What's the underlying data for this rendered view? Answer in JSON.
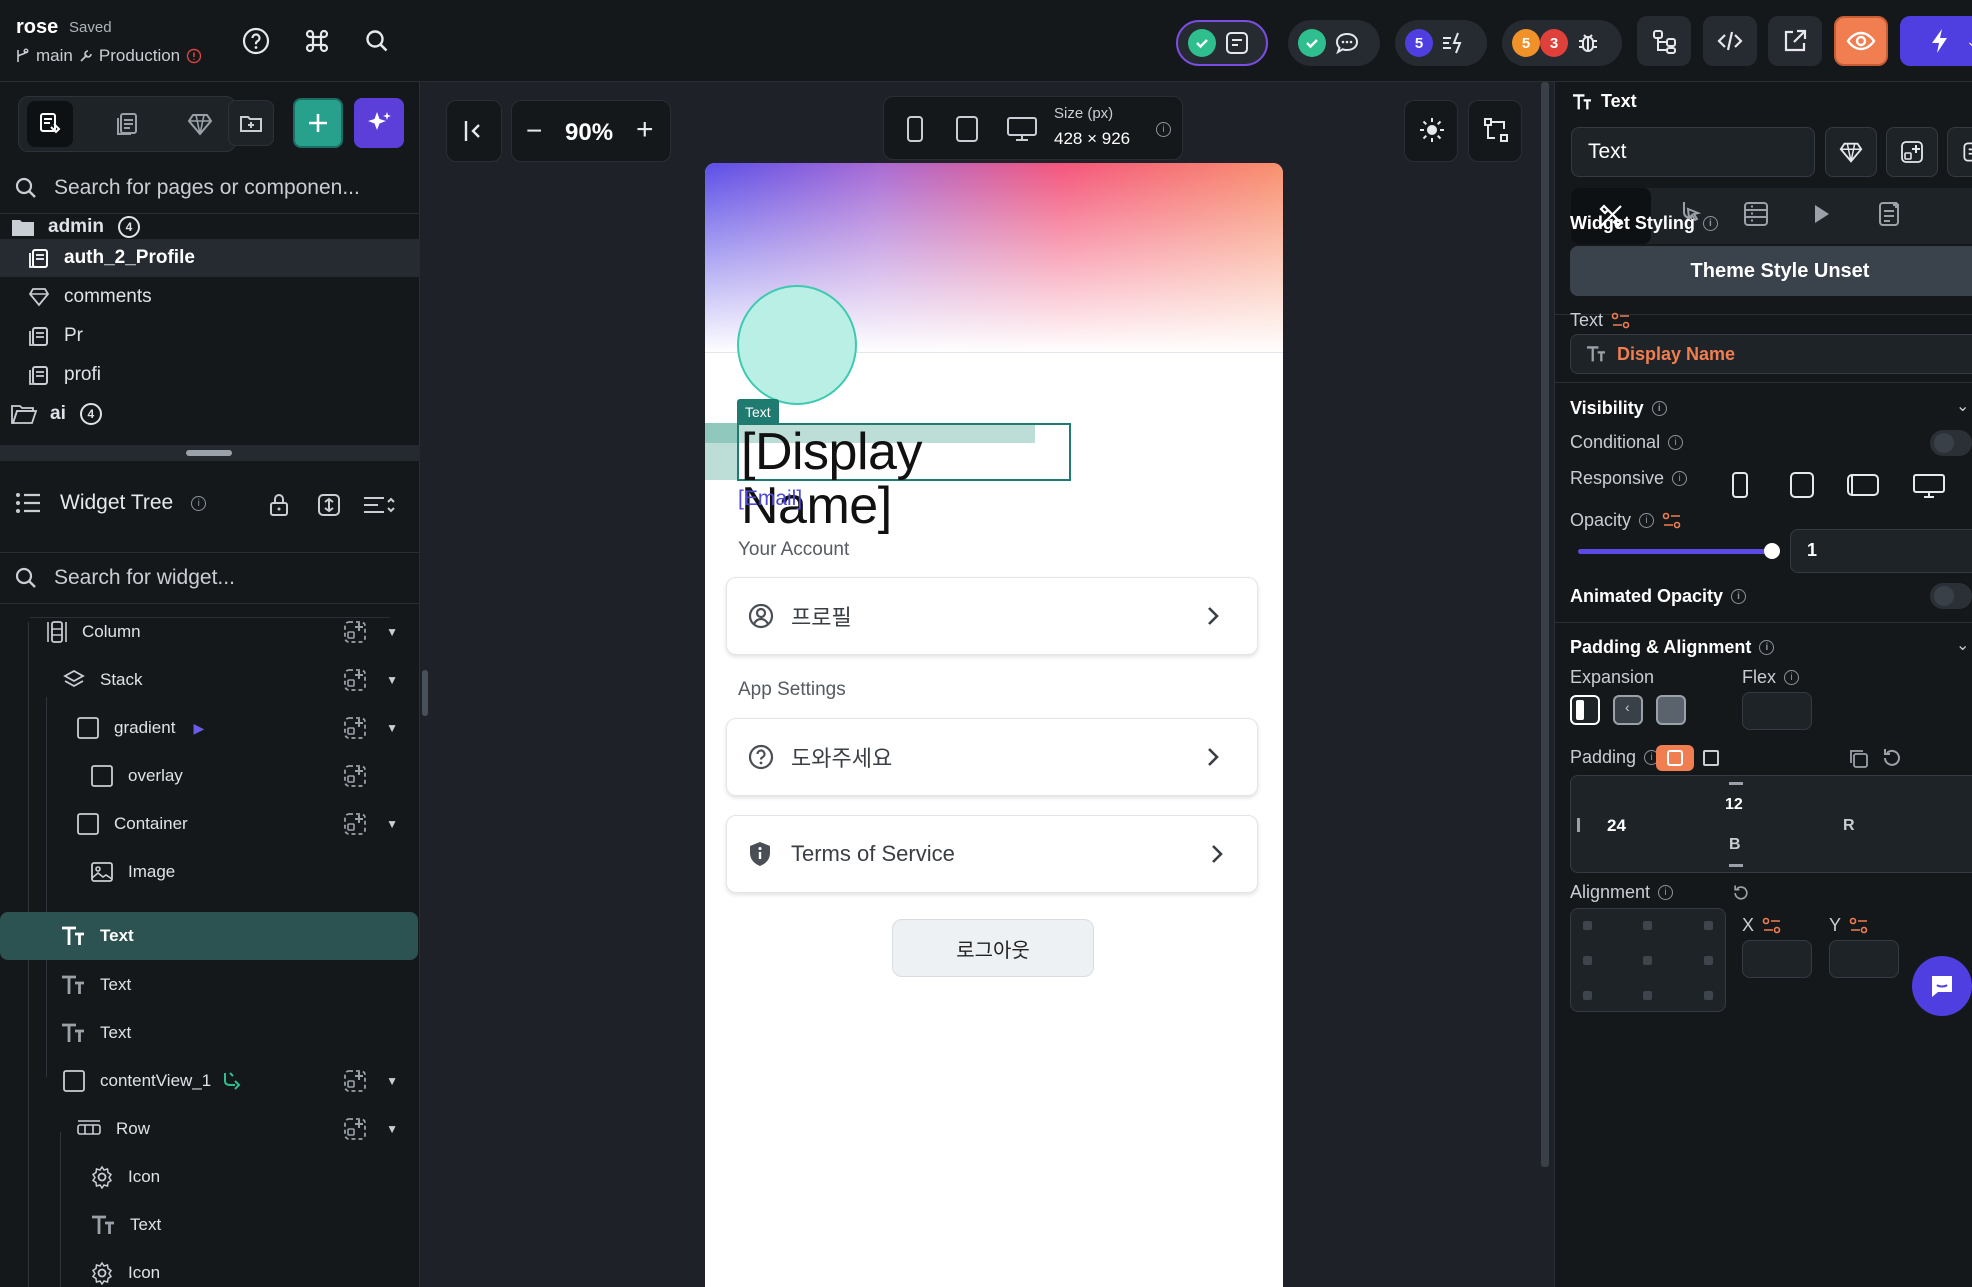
{
  "topbar": {
    "project_name": "rose",
    "saved_status": "Saved",
    "branch": "main",
    "environment": "Production",
    "badges": {
      "blue_count": "5",
      "orange_count": "5",
      "red_count": "3"
    },
    "colors": {
      "ok": "#2fbf8f",
      "blue": "#4f3ee0",
      "orange": "#f0912a",
      "red": "#e0403a",
      "preview": "#f07e50",
      "run": "#4f3ee0"
    }
  },
  "left": {
    "page_search_placeholder": "Search for pages or componen...",
    "folder_admin": "admin",
    "folder_admin_count": "4",
    "pages": [
      "auth_2_Profile",
      "comments",
      "Pr",
      "profi"
    ],
    "folder_ai": "ai",
    "folder_ai_count": "4",
    "widget_tree_title": "Widget Tree",
    "widget_search_placeholder": "Search for widget...",
    "tree": [
      {
        "label": "Column"
      },
      {
        "label": "Stack"
      },
      {
        "label": "gradient"
      },
      {
        "label": "overlay"
      },
      {
        "label": "Container"
      },
      {
        "label": "Image"
      },
      {
        "label": "Text"
      },
      {
        "label": "Text"
      },
      {
        "label": "Text"
      },
      {
        "label": "contentView_1"
      },
      {
        "label": "Row"
      },
      {
        "label": "Icon"
      },
      {
        "label": "Text"
      },
      {
        "label": "Icon"
      }
    ]
  },
  "canvas": {
    "zoom": "90%",
    "size_label": "Size (px)",
    "size_value": "428 × 926",
    "phone": {
      "selected_tag": "Text",
      "display_name": "[Display Name]",
      "email": "[Email]",
      "section_account": "Your Account",
      "item_profile": "프로필",
      "section_settings": "App Settings",
      "item_help": "도와주세요",
      "item_terms": "Terms of Service",
      "logout": "로그아웃"
    }
  },
  "right": {
    "widget_type": "Text",
    "widget_name_value": "Text",
    "widget_styling": "Widget Styling",
    "theme_style": "Theme Style Unset",
    "text_label": "Text",
    "text_value": "Display Name",
    "visibility": "Visibility",
    "conditional": "Conditional",
    "responsive": "Responsive",
    "opacity": "Opacity",
    "opacity_value": "1",
    "opacity_fraction": 1.0,
    "animated_opacity": "Animated Opacity",
    "padding_alignment": "Padding & Alignment",
    "expansion": "Expansion",
    "flex": "Flex",
    "padding": "Padding",
    "padding_top": "12",
    "padding_left": "24",
    "padding_right": "R",
    "padding_bottom": "B",
    "alignment": "Alignment",
    "align_x": "X",
    "align_y": "Y"
  }
}
